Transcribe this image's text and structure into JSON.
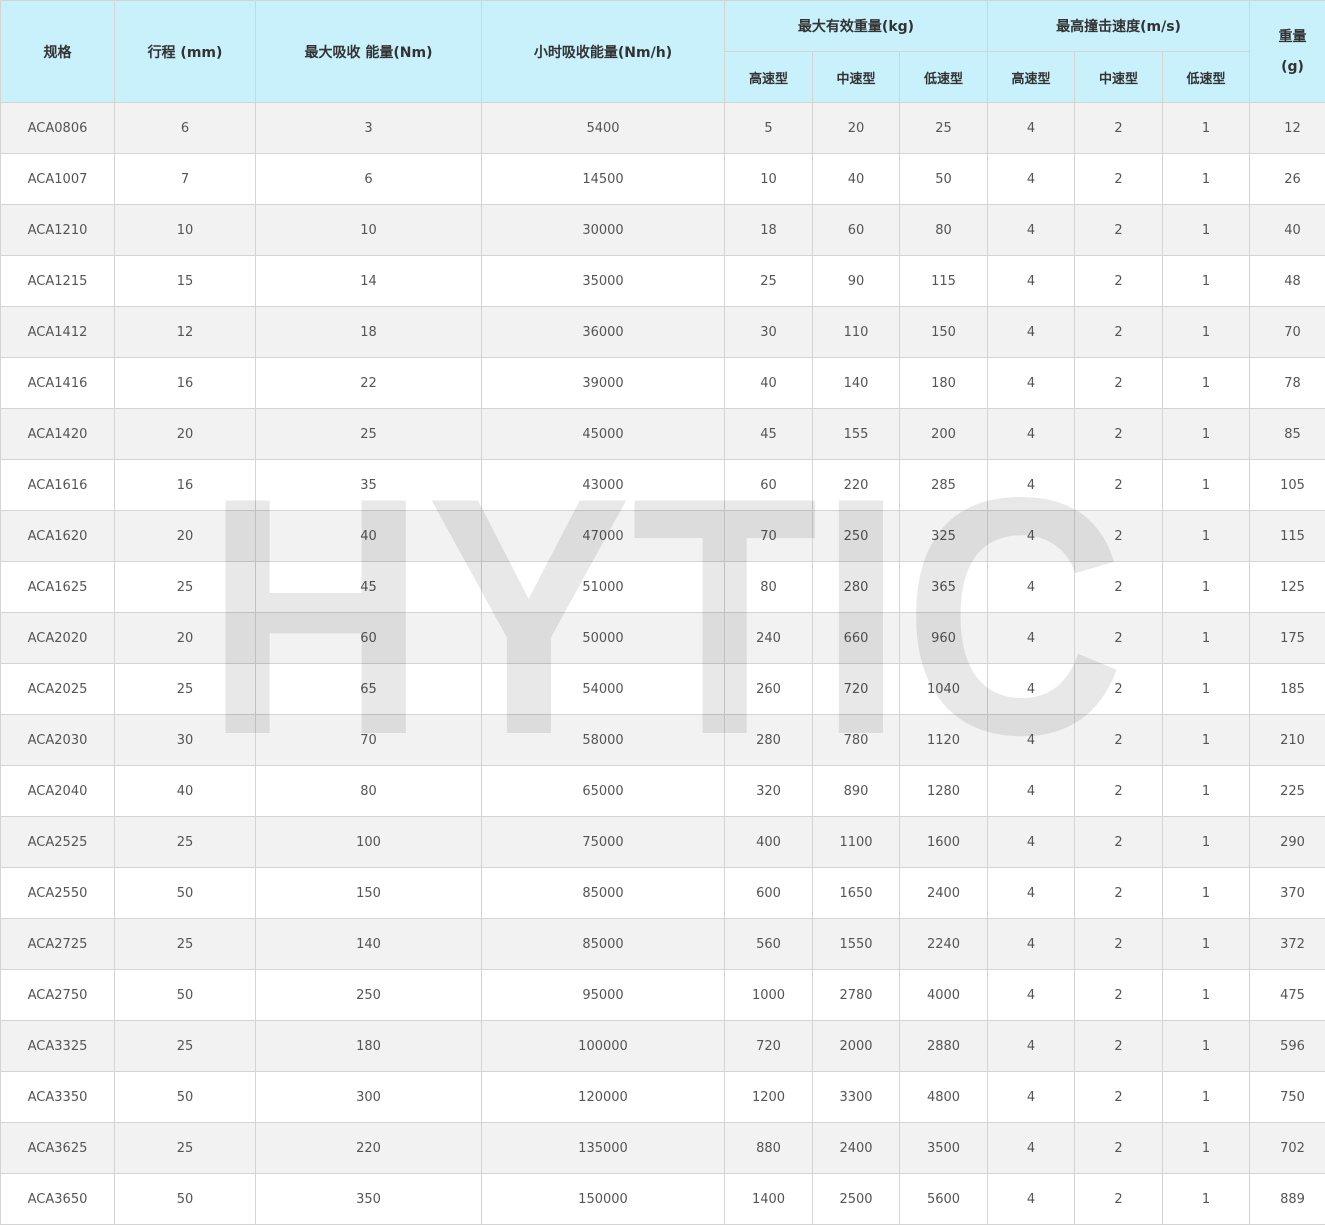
{
  "header": {
    "spec": "规格",
    "stroke": "行程 (mm)",
    "max_energy": "最大吸收 能量(Nm)",
    "hourly_energy": "小时吸收能量(Nm/h)",
    "max_mass": "最大有效重量(kg)",
    "max_speed": "最高撞击速度(m/s)",
    "weight_line1": "重量",
    "weight_line2": "(g)",
    "sub": {
      "mass_high": "高速型",
      "mass_mid": "中速型",
      "mass_low": "低速型",
      "speed_high": "高速型",
      "speed_mid": "中速型",
      "speed_low": "低速型"
    }
  },
  "watermark": "HYTIC",
  "rows": [
    {
      "model": "ACA0806",
      "stroke": "6",
      "energy": "3",
      "hourly": "5400",
      "mh": "5",
      "mm": "20",
      "ml": "25",
      "sh": "4",
      "sm": "2",
      "sl": "1",
      "weight": "12"
    },
    {
      "model": "ACA1007",
      "stroke": "7",
      "energy": "6",
      "hourly": "14500",
      "mh": "10",
      "mm": "40",
      "ml": "50",
      "sh": "4",
      "sm": "2",
      "sl": "1",
      "weight": "26"
    },
    {
      "model": "ACA1210",
      "stroke": "10",
      "energy": "10",
      "hourly": "30000",
      "mh": "18",
      "mm": "60",
      "ml": "80",
      "sh": "4",
      "sm": "2",
      "sl": "1",
      "weight": "40"
    },
    {
      "model": "ACA1215",
      "stroke": "15",
      "energy": "14",
      "hourly": "35000",
      "mh": "25",
      "mm": "90",
      "ml": "115",
      "sh": "4",
      "sm": "2",
      "sl": "1",
      "weight": "48"
    },
    {
      "model": "ACA1412",
      "stroke": "12",
      "energy": "18",
      "hourly": "36000",
      "mh": "30",
      "mm": "110",
      "ml": "150",
      "sh": "4",
      "sm": "2",
      "sl": "1",
      "weight": "70"
    },
    {
      "model": "ACA1416",
      "stroke": "16",
      "energy": "22",
      "hourly": "39000",
      "mh": "40",
      "mm": "140",
      "ml": "180",
      "sh": "4",
      "sm": "2",
      "sl": "1",
      "weight": "78"
    },
    {
      "model": "ACA1420",
      "stroke": "20",
      "energy": "25",
      "hourly": "45000",
      "mh": "45",
      "mm": "155",
      "ml": "200",
      "sh": "4",
      "sm": "2",
      "sl": "1",
      "weight": "85"
    },
    {
      "model": "ACA1616",
      "stroke": "16",
      "energy": "35",
      "hourly": "43000",
      "mh": "60",
      "mm": "220",
      "ml": "285",
      "sh": "4",
      "sm": "2",
      "sl": "1",
      "weight": "105"
    },
    {
      "model": "ACA1620",
      "stroke": "20",
      "energy": "40",
      "hourly": "47000",
      "mh": "70",
      "mm": "250",
      "ml": "325",
      "sh": "4",
      "sm": "2",
      "sl": "1",
      "weight": "115"
    },
    {
      "model": "ACA1625",
      "stroke": "25",
      "energy": "45",
      "hourly": "51000",
      "mh": "80",
      "mm": "280",
      "ml": "365",
      "sh": "4",
      "sm": "2",
      "sl": "1",
      "weight": "125"
    },
    {
      "model": "ACA2020",
      "stroke": "20",
      "energy": "60",
      "hourly": "50000",
      "mh": "240",
      "mm": "660",
      "ml": "960",
      "sh": "4",
      "sm": "2",
      "sl": "1",
      "weight": "175"
    },
    {
      "model": "ACA2025",
      "stroke": "25",
      "energy": "65",
      "hourly": "54000",
      "mh": "260",
      "mm": "720",
      "ml": "1040",
      "sh": "4",
      "sm": "2",
      "sl": "1",
      "weight": "185"
    },
    {
      "model": "ACA2030",
      "stroke": "30",
      "energy": "70",
      "hourly": "58000",
      "mh": "280",
      "mm": "780",
      "ml": "1120",
      "sh": "4",
      "sm": "2",
      "sl": "1",
      "weight": "210"
    },
    {
      "model": "ACA2040",
      "stroke": "40",
      "energy": "80",
      "hourly": "65000",
      "mh": "320",
      "mm": "890",
      "ml": "1280",
      "sh": "4",
      "sm": "2",
      "sl": "1",
      "weight": "225"
    },
    {
      "model": "ACA2525",
      "stroke": "25",
      "energy": "100",
      "hourly": "75000",
      "mh": "400",
      "mm": "1100",
      "ml": "1600",
      "sh": "4",
      "sm": "2",
      "sl": "1",
      "weight": "290"
    },
    {
      "model": "ACA2550",
      "stroke": "50",
      "energy": "150",
      "hourly": "85000",
      "mh": "600",
      "mm": "1650",
      "ml": "2400",
      "sh": "4",
      "sm": "2",
      "sl": "1",
      "weight": "370"
    },
    {
      "model": "ACA2725",
      "stroke": "25",
      "energy": "140",
      "hourly": "85000",
      "mh": "560",
      "mm": "1550",
      "ml": "2240",
      "sh": "4",
      "sm": "2",
      "sl": "1",
      "weight": "372"
    },
    {
      "model": "ACA2750",
      "stroke": "50",
      "energy": "250",
      "hourly": "95000",
      "mh": "1000",
      "mm": "2780",
      "ml": "4000",
      "sh": "4",
      "sm": "2",
      "sl": "1",
      "weight": "475"
    },
    {
      "model": "ACA3325",
      "stroke": "25",
      "energy": "180",
      "hourly": "100000",
      "mh": "720",
      "mm": "2000",
      "ml": "2880",
      "sh": "4",
      "sm": "2",
      "sl": "1",
      "weight": "596"
    },
    {
      "model": "ACA3350",
      "stroke": "50",
      "energy": "300",
      "hourly": "120000",
      "mh": "1200",
      "mm": "3300",
      "ml": "4800",
      "sh": "4",
      "sm": "2",
      "sl": "1",
      "weight": "750"
    },
    {
      "model": "ACA3625",
      "stroke": "25",
      "energy": "220",
      "hourly": "135000",
      "mh": "880",
      "mm": "2400",
      "ml": "3500",
      "sh": "4",
      "sm": "2",
      "sl": "1",
      "weight": "702"
    },
    {
      "model": "ACA3650",
      "stroke": "50",
      "energy": "350",
      "hourly": "150000",
      "mh": "1400",
      "mm": "2500",
      "ml": "5600",
      "sh": "4",
      "sm": "2",
      "sl": "1",
      "weight": "889"
    }
  ]
}
